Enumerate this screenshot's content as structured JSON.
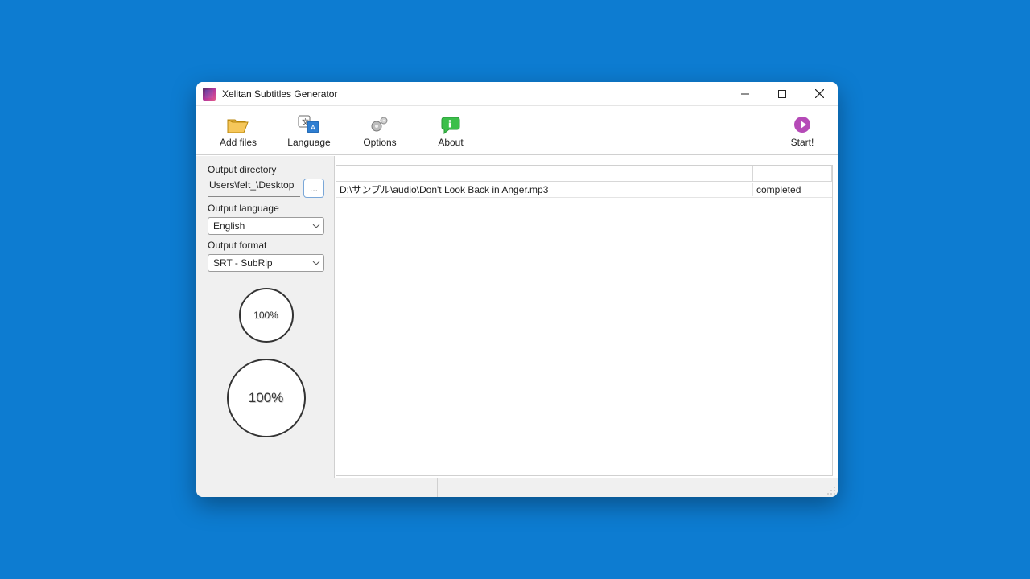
{
  "window": {
    "title": "Xelitan Subtitles Generator"
  },
  "toolbar": {
    "add_files": "Add files",
    "language": "Language",
    "options": "Options",
    "about": "About",
    "start": "Start!"
  },
  "sidebar": {
    "output_dir_label": "Output directory",
    "output_dir_value": "Users\\feIt_\\Desktop",
    "browse_label": "...",
    "output_lang_label": "Output language",
    "output_lang_value": "English",
    "output_fmt_label": "Output format",
    "output_fmt_value": "SRT - SubRip"
  },
  "progress": {
    "small": "100%",
    "large": "100%"
  },
  "table": {
    "rows": [
      {
        "file": "D:\\サンプル\\audio\\Don't Look Back in Anger.mp3",
        "status": "completed"
      }
    ]
  }
}
